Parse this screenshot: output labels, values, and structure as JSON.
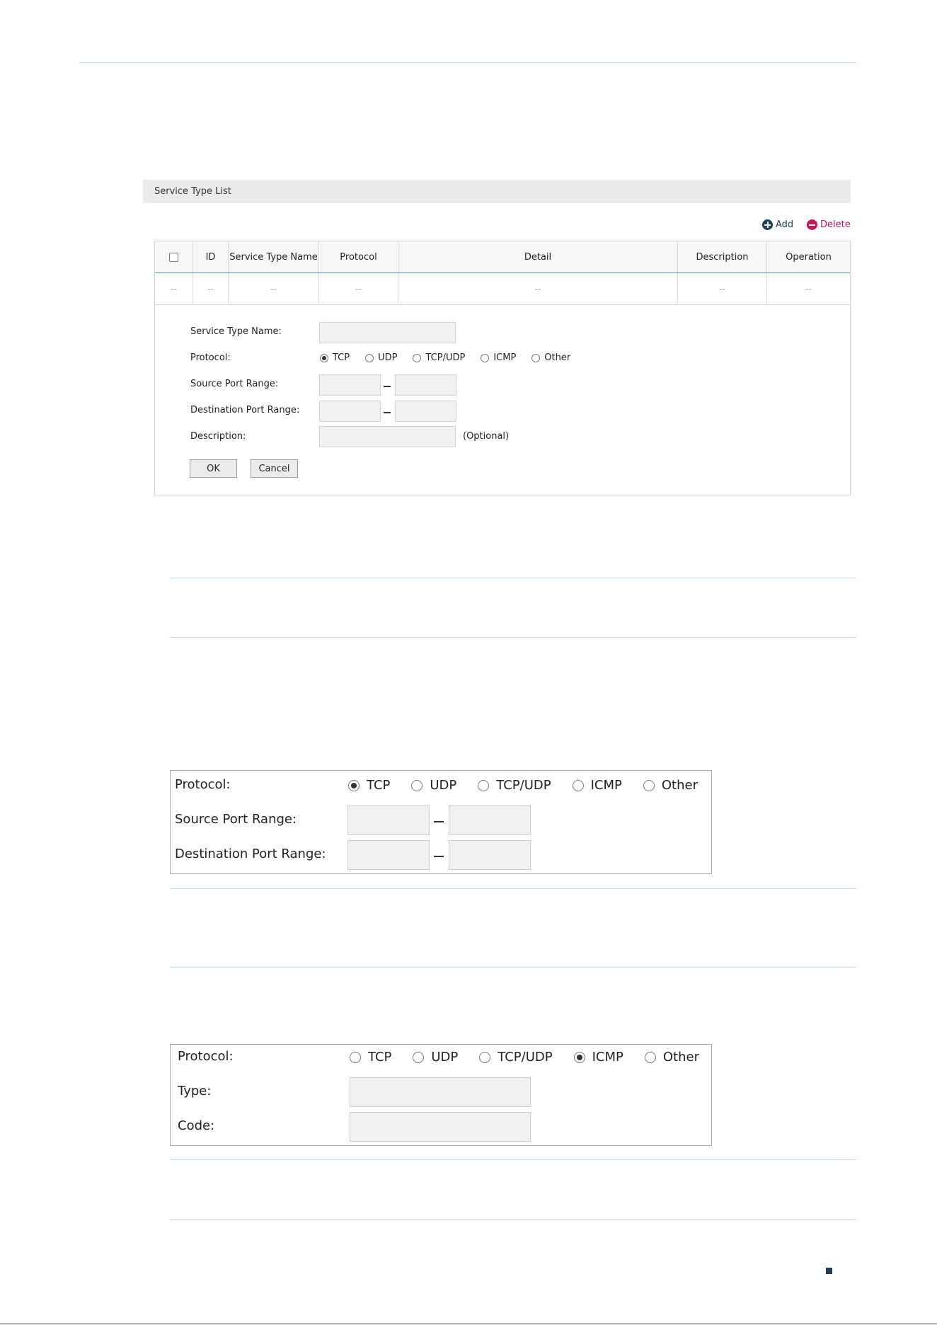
{
  "panel": {
    "title": "Service Type List",
    "add_label": "Add",
    "delete_label": "Delete"
  },
  "table": {
    "columns": [
      "ID",
      "Service Type Name",
      "Protocol",
      "Detail",
      "Description",
      "Operation"
    ],
    "row": [
      "--",
      "--",
      "--",
      "--",
      "--",
      "--",
      "--"
    ]
  },
  "form": {
    "name_label": "Service Type Name:",
    "protocol_label": "Protocol:",
    "src_label": "Source Port Range:",
    "dst_label": "Destination Port Range:",
    "desc_label": "Description:",
    "optional": "(Optional)",
    "protocols": [
      "TCP",
      "UDP",
      "TCP/UDP",
      "ICMP",
      "Other"
    ],
    "selected": "TCP",
    "ok": "OK",
    "cancel": "Cancel"
  },
  "tcp_box": {
    "protocol_label": "Protocol:",
    "src_label": "Source Port Range:",
    "dst_label": "Destination Port Range:",
    "protocols": [
      "TCP",
      "UDP",
      "TCP/UDP",
      "ICMP",
      "Other"
    ],
    "selected": "TCP"
  },
  "icmp_box": {
    "protocol_label": "Protocol:",
    "type_label": "Type:",
    "code_label": "Code:",
    "protocols": [
      "TCP",
      "UDP",
      "TCP/UDP",
      "ICMP",
      "Other"
    ],
    "selected": "ICMP"
  },
  "colors": {
    "add": "#1f3f55",
    "delete": "#c2185b",
    "rule": "#c9dde8"
  }
}
